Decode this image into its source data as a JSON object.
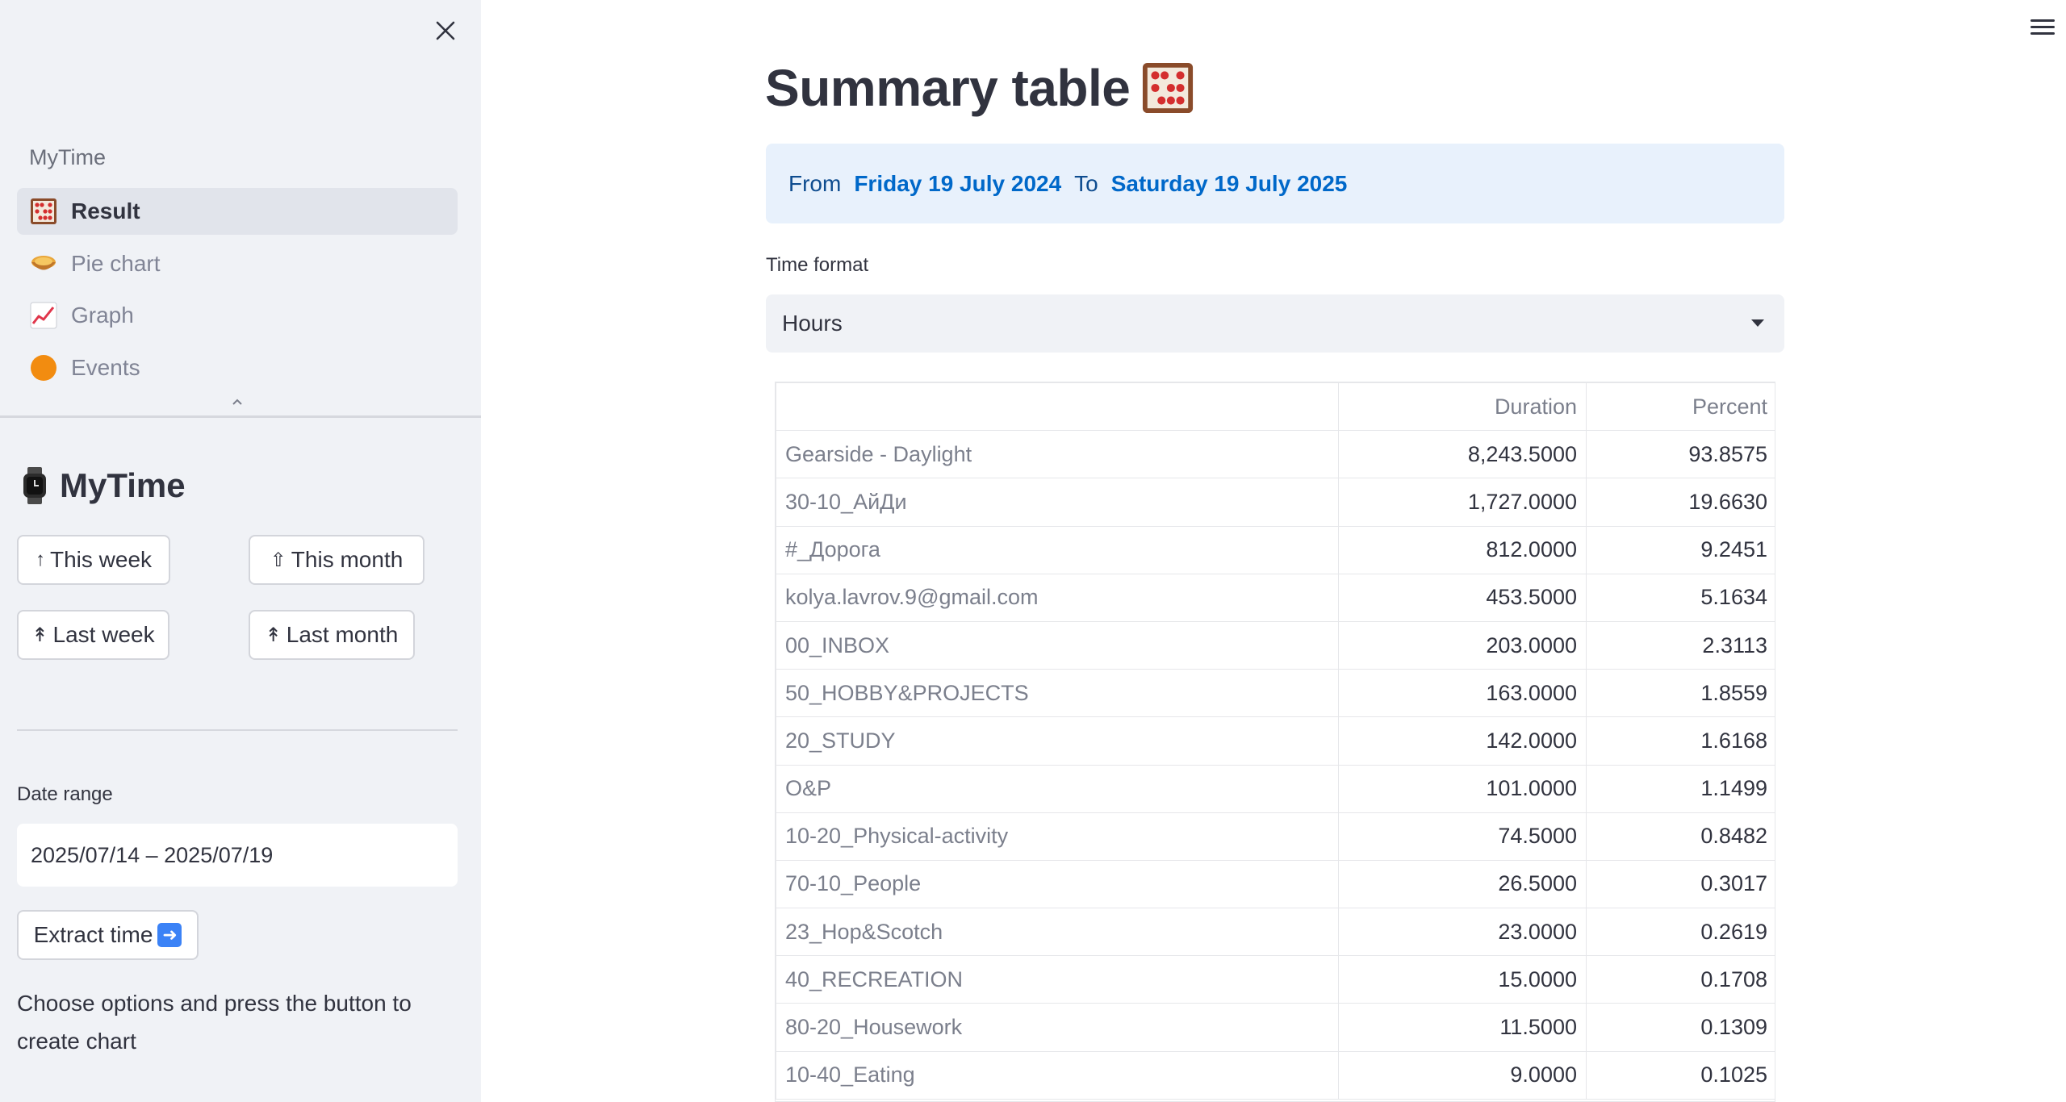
{
  "sidebar": {
    "nav_heading": "MyTime",
    "nav_items": [
      {
        "label": "Result",
        "icon": "abacus-icon",
        "active": true
      },
      {
        "label": "Pie chart",
        "icon": "pie-icon",
        "active": false
      },
      {
        "label": "Graph",
        "icon": "chart-increasing-icon",
        "active": false
      },
      {
        "label": "Events",
        "icon": "orange-circle-icon",
        "active": false
      }
    ],
    "title": "MyTime",
    "title_icon": "watch-icon",
    "buttons": {
      "this_week": "This week",
      "this_month": "This month",
      "last_week": "Last week",
      "last_month": "Last month"
    },
    "date_label": "Date range",
    "date_value": "2025/07/14 – 2025/07/19",
    "extract_label": "Extract time",
    "hint": "Choose options and press the button to create chart"
  },
  "main": {
    "title": "Summary table",
    "title_icon": "abacus-icon",
    "info": {
      "from_word": "From",
      "from_date": "Friday 19 July 2024",
      "to_word": "To",
      "to_date": "Saturday 19 July 2025"
    },
    "time_format_label": "Time format",
    "time_format_value": "Hours",
    "table": {
      "columns": [
        "",
        "Duration",
        "Percent"
      ],
      "rows": [
        [
          "Gearside - Daylight",
          "8,243.5000",
          "93.8575"
        ],
        [
          "30-10_АйДи",
          "1,727.0000",
          "19.6630"
        ],
        [
          "#_Дорога",
          "812.0000",
          "9.2451"
        ],
        [
          "kolya.lavrov.9@gmail.com",
          "453.5000",
          "5.1634"
        ],
        [
          "00_INBOX",
          "203.0000",
          "2.3113"
        ],
        [
          "50_HOBBY&PROJECTS",
          "163.0000",
          "1.8559"
        ],
        [
          "20_STUDY",
          "142.0000",
          "1.6168"
        ],
        [
          "O&P",
          "101.0000",
          "1.1499"
        ],
        [
          "10-20_Physical-activity",
          "74.5000",
          "0.8482"
        ],
        [
          "70-10_People",
          "26.5000",
          "0.3017"
        ],
        [
          "23_Hop&Scotch",
          "23.0000",
          "0.2619"
        ],
        [
          "40_RECREATION",
          "15.0000",
          "0.1708"
        ],
        [
          "80-20_Housework",
          "11.5000",
          "0.1309"
        ],
        [
          "10-40_Eating",
          "9.0000",
          "0.1025"
        ]
      ]
    }
  },
  "colors": {
    "sidebar_bg": "#f0f2f6",
    "info_bg": "#e8f1fc",
    "accent": "#0068c9",
    "text": "#31333f"
  }
}
